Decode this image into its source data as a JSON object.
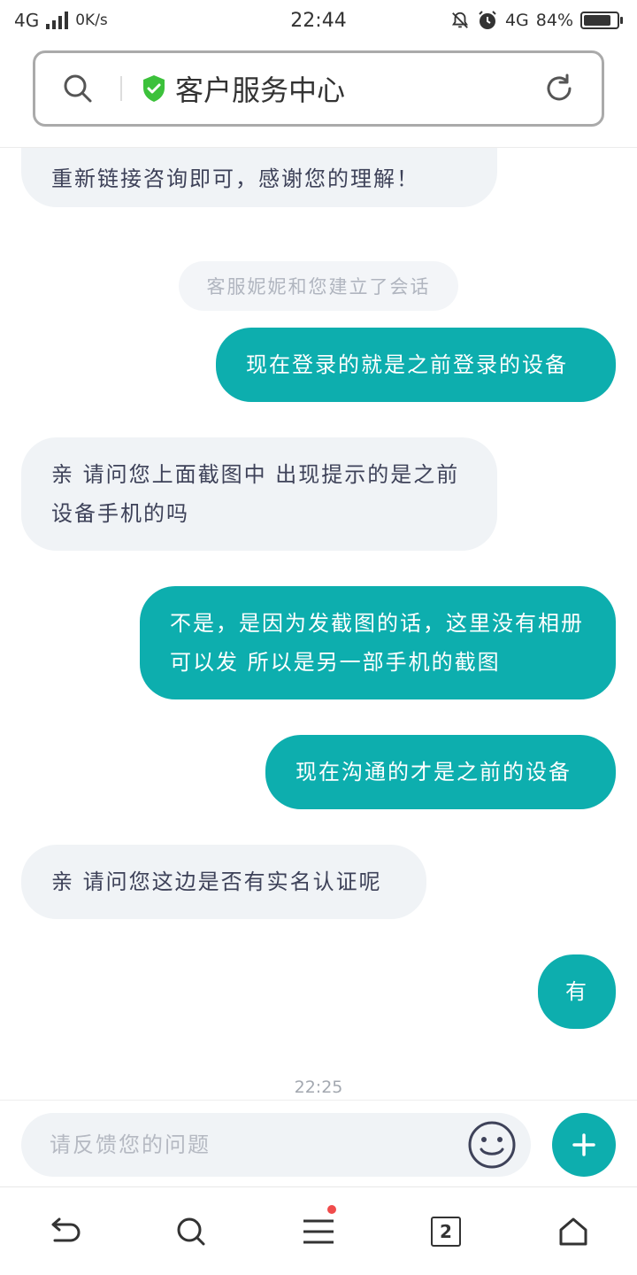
{
  "status_bar": {
    "network_left": "4G",
    "speed": "0K/s",
    "time": "22:44",
    "network_right": "4G",
    "battery": "84%",
    "battery_level": 0.84
  },
  "address_bar": {
    "title": "客户服务中心"
  },
  "chat": {
    "system_note": "客服妮妮和您建立了会话",
    "messages": [
      {
        "side": "left",
        "text": "重新链接咨询即可，感谢您的理解！"
      },
      {
        "side": "right",
        "text": "现在登录的就是之前登录的设备"
      },
      {
        "side": "left",
        "text": "亲 请问您上面截图中 出现提示的是之前设备手机的吗"
      },
      {
        "side": "right",
        "text": "不是，是因为发截图的话，这里没有相册可以发 所以是另一部手机的截图"
      },
      {
        "side": "right",
        "text": "现在沟通的才是之前的设备"
      },
      {
        "side": "left",
        "text": "亲 请问您这边是否有实名认证呢"
      },
      {
        "side": "right",
        "text": "有"
      }
    ],
    "timestamp": "22:25"
  },
  "input": {
    "placeholder": "请反馈您的问题"
  },
  "bottom_nav": {
    "tabs_count": "2",
    "icons": [
      "back-icon",
      "search-icon",
      "menu-icon",
      "tabs-icon",
      "home-icon"
    ]
  },
  "colors": {
    "accent": "#0daeae",
    "incoming_bubble": "#f0f3f6",
    "shield": "#3cc13b",
    "notification_dot": "#f04b4b"
  }
}
